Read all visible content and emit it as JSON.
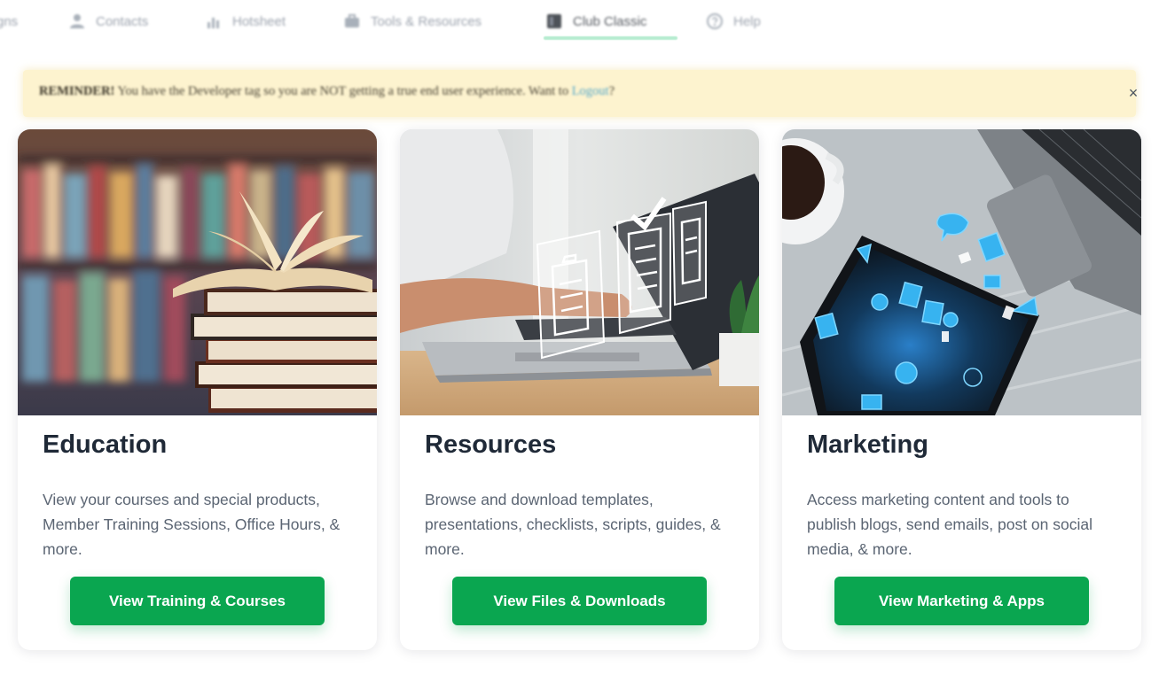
{
  "nav": {
    "items": [
      {
        "label": "gns",
        "icon": "none"
      },
      {
        "label": "Contacts",
        "icon": "person-icon"
      },
      {
        "label": "Hotsheet",
        "icon": "chart-icon"
      },
      {
        "label": "Tools & Resources",
        "icon": "briefcase-icon"
      },
      {
        "label": "Club Classic",
        "icon": "book-icon"
      },
      {
        "label": "Help",
        "icon": "help-icon"
      }
    ],
    "active": "Club Classic"
  },
  "banner": {
    "bold": "REMINDER!",
    "text": " You have the Developer tag so you are NOT getting a true end user experience. Want to ",
    "link": "Logout",
    "end": "?",
    "close": "×"
  },
  "cards": [
    {
      "title": "Education",
      "description": "View your courses and special products, Member Training Sessions, Office Hours, & more.",
      "button": "View Training & Courses",
      "image": "stacked-books-photo"
    },
    {
      "title": "Resources",
      "description": "Browse and download templates, presentations, checklists, scripts, guides, & more.",
      "button": "View Files & Downloads",
      "image": "laptop-documents-photo"
    },
    {
      "title": "Marketing",
      "description": "Access marketing content and tools to publish blogs, send emails, post on social media, & more.",
      "button": "View Marketing & Apps",
      "image": "tablet-marketing-icons-photo"
    }
  ],
  "colors": {
    "accent": "#0aa650",
    "banner_bg": "#fdf3cf"
  }
}
